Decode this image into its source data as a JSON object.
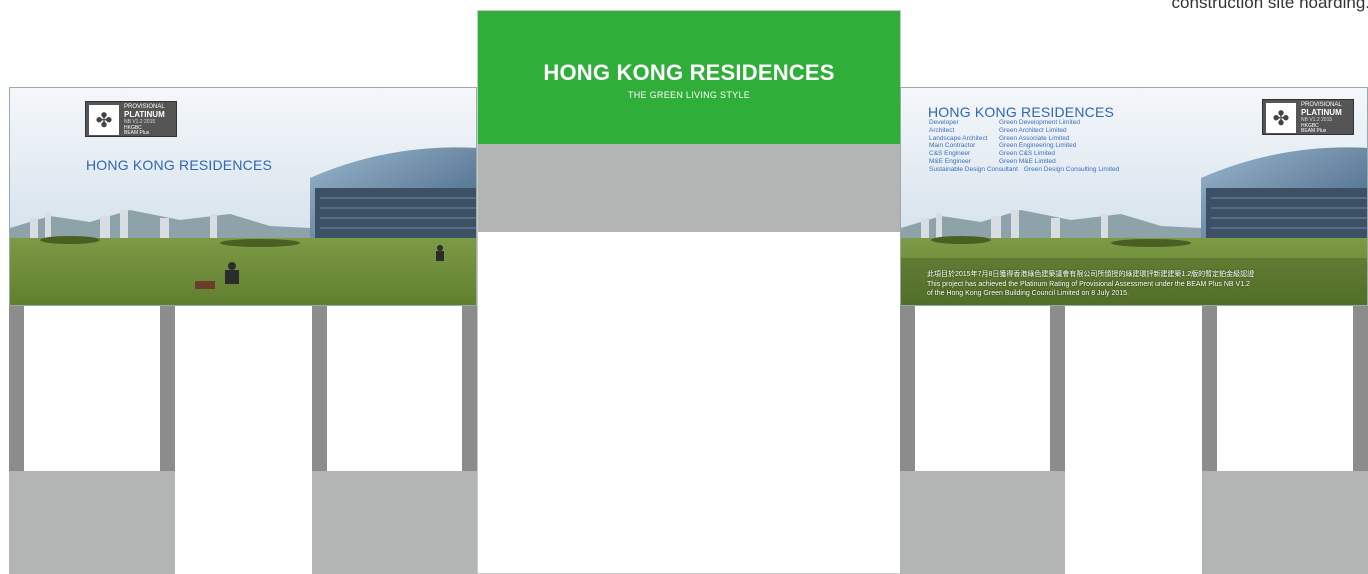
{
  "caption": "construction site hoarding.",
  "center": {
    "title": "HONG KONG RESIDENCES",
    "subtitle": "THE GREEN LIVING STYLE"
  },
  "logo": {
    "line1": "PROVISIONAL",
    "line2": "PLATINUM",
    "line3": "NB V1.2 2015",
    "line4": "HKGBC",
    "line5": "BEAM Plus"
  },
  "left_board": {
    "title": "HONG KONG RESIDENCES"
  },
  "right_board": {
    "title": "HONG KONG RESIDENCES",
    "credits": [
      {
        "role": "Developer",
        "name": "Green Development Limited"
      },
      {
        "role": "Architect",
        "name": "Green Architect Limited"
      },
      {
        "role": "Landscape Architect",
        "name": "Green Associate Limited"
      },
      {
        "role": "Main Contractor",
        "name": "Green Engineering Limited"
      },
      {
        "role": "C&S Engineer",
        "name": "Green C&S Limited"
      },
      {
        "role": "M&E Engineer",
        "name": "Green M&E Limited"
      },
      {
        "role": "Sustainable Design Consultant",
        "name": "Green Design Consulting Limited"
      }
    ],
    "achievement": [
      "此項目於2015年7月8日獲得香港綠色建築議會有限公司所頒授的綠建環評新建建築1.2版的暫定鉑金級認證",
      "This project has achieved the Platinum Rating of Provisional Assessment under the BEAM Plus NB V1.2",
      "of the Hong Kong Green Building Council Limited on 8 July 2015."
    ]
  },
  "colors": {
    "green": "#2fae3a",
    "grey_panel": "#b3b5b4",
    "post": "#8c8c8c",
    "title_blue": "#2f67b1"
  }
}
